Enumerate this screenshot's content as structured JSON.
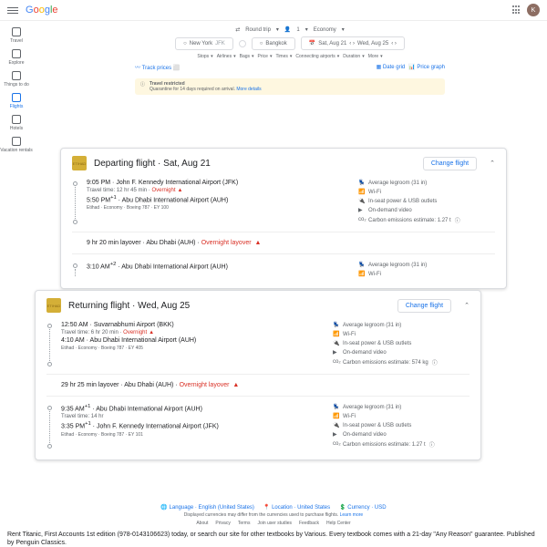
{
  "header": {
    "avatar": "K"
  },
  "sidebar": {
    "items": [
      {
        "label": "Travel"
      },
      {
        "label": "Explore"
      },
      {
        "label": "Things to do"
      },
      {
        "label": "Flights"
      },
      {
        "label": "Hotels"
      },
      {
        "label": "Vacation rentals"
      }
    ]
  },
  "search": {
    "trip": "Round trip",
    "pax": "1",
    "class": "Economy",
    "from": "New York",
    "fromCode": "JFK",
    "to": "Bangkok",
    "d1": "Sat, Aug 21",
    "d2": "Wed, Aug 25",
    "filters": [
      "Stops",
      "Airlines",
      "Bags",
      "Price",
      "Times",
      "Connecting airports",
      "Duration",
      "More"
    ],
    "track": "Track prices",
    "dategrid": "Date grid",
    "pricegraph": "Price graph"
  },
  "notice": {
    "title": "Travel restricted",
    "sub": "Quarantine for 14 days required on arrival.",
    "more": "More details"
  },
  "cards": [
    {
      "title": "Departing flight",
      "date": "Sat, Aug 21",
      "btn": "Change flight",
      "airline": "ETIHAD",
      "segs": [
        {
          "t1": "9:05 PM",
          "a1": "John F. Kennedy International Airport (JFK)",
          "dur": "Travel time: 12 hr 45 min",
          "ov": "Overnight",
          "t2": "5:50 PM",
          "sup": "+1",
          "a2": "Abu Dhabi International Airport (AUH)",
          "meta": "Etihad · Economy · Boeing 787 · EY 100",
          "co2": "Carbon emissions estimate: 1.27 t"
        },
        {
          "t1": "3:10 AM",
          "sup1": "+2",
          "a1": "Abu Dhabi International Airport (AUH)"
        }
      ],
      "lay": {
        "dur": "9 hr 20 min layover",
        "loc": "Abu Dhabi (AUH)",
        "ov": "Overnight layover"
      }
    },
    {
      "title": "Returning flight",
      "date": "Wed, Aug 25",
      "btn": "Change flight",
      "airline": "ETIHAD",
      "segs": [
        {
          "t1": "12:50 AM",
          "a1": "Suvarnabhumi Airport (BKK)",
          "dur": "Travel time: 6 hr 20 min",
          "ov": "Overnight",
          "t2": "4:10 AM",
          "a2": "Abu Dhabi International Airport (AUH)",
          "meta": "Etihad · Economy · Boeing 787 · EY 405",
          "co2": "Carbon emissions estimate: 574 kg"
        },
        {
          "t1": "9:35 AM",
          "sup1": "+1",
          "a1": "Abu Dhabi International Airport (AUH)",
          "dur": "Travel time: 14 hr",
          "t2": "3:35 PM",
          "sup": "+1",
          "a2": "John F. Kennedy International Airport (JFK)",
          "meta": "Etihad · Economy · Boeing 787 · EY 101",
          "co2": "Carbon emissions estimate: 1.27 t"
        }
      ],
      "lay": {
        "dur": "29 hr 25 min layover",
        "loc": "Abu Dhabi (AUH)",
        "ov": "Overnight layover"
      }
    }
  ],
  "amen": {
    "leg": "Average legroom (31 in)",
    "wifi": "Wi-Fi",
    "power": "In-seat power & USB outlets",
    "video": "On-demand video"
  },
  "footer": {
    "lang": "Language · English (United States)",
    "loc": "Location · United States",
    "cur": "Currency · USD",
    "links": [
      "About",
      "Privacy",
      "Terms",
      "Join user studies",
      "Feedback",
      "Help Center"
    ],
    "disc": "Displayed currencies may differ from the currencies used to purchase flights.",
    "learn": "Learn more"
  },
  "bottom": "Rent Titanic, First Accounts 1st edition (978-0143106623) today, or search our site for other textbooks by Various. Every textbook comes with a 21-day \"Any Reason\" guarantee. Published by Penguin Classics."
}
